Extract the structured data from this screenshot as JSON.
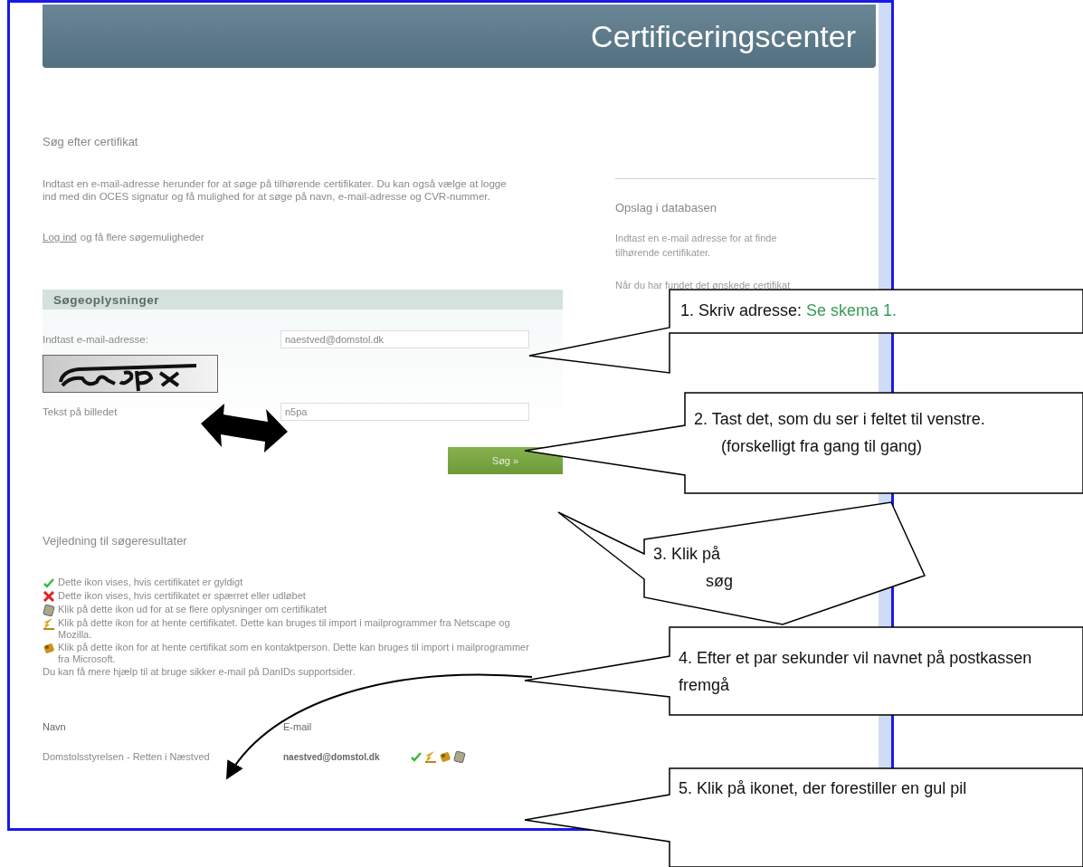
{
  "header": {
    "title": "Certificeringscenter"
  },
  "main": {
    "heading": "Søg efter certifikat",
    "intro": "Indtast en e-mail-adresse herunder for at søge på tilhørende certifikater. Du kan også vælge at logge ind med din OCES signatur og få mulighed for at søge på navn, e-mail-adresse og CVR-nummer.",
    "login_link": "Log ind",
    "login_rest": "og få flere søgemuligheder",
    "form": {
      "title": "Søgeoplysninger",
      "email_label": "Indtast e-mail-adresse:",
      "email_value": "naestved@domstol.dk",
      "captcha_label": "Tekst på billedet",
      "captcha_value": "n5pa",
      "submit": "Søg »"
    },
    "guide": {
      "heading": "Vejledning til søgeresultater",
      "items": [
        {
          "kind": "valid",
          "text": "Dette ikon vises, hvis certifikatet er gyldigt"
        },
        {
          "kind": "revoked",
          "text": "Dette ikon vises, hvis certifikatet er spærret eller udløbet"
        },
        {
          "kind": "info",
          "text": "Klik på dette ikon ud for at se flere oplysninger om certifikatet"
        },
        {
          "kind": "download",
          "text": "Klik på dette ikon for at hente certifikatet. Dette kan bruges til import i mailprogrammer fra Netscape og Mozilla."
        },
        {
          "kind": "contact",
          "text": "Klik på dette ikon for at hente certifikat som en kontaktperson. Dette kan bruges til import i mailprogrammer fra Microsoft."
        }
      ],
      "footer": "Du kan få mere hjælp til at bruge sikker e-mail på DanIDs supportsider."
    },
    "results": {
      "columns": [
        "Navn",
        "E-mail"
      ],
      "rows": [
        {
          "name": "Domstolsstyrelsen - Retten i Næstved",
          "email": "naestved@domstol.dk",
          "actions": [
            {
              "kind": "valid"
            },
            {
              "kind": "download"
            },
            {
              "kind": "contact"
            },
            {
              "kind": "info"
            }
          ]
        }
      ]
    }
  },
  "sidebar": {
    "heading": "Opslag i databasen",
    "paragraphs": [
      "Indtast en e-mail adresse for at finde tilhørende certifikater.",
      "Når du har fundet det ønskede certifikat"
    ]
  },
  "callouts": [
    {
      "lines": [
        "1. Skriv adresse:"
      ],
      "link": "Se skema 1."
    },
    {
      "lines": [
        "2. Tast det, som du ser i feltet til venstre.",
        "(forskelligt fra gang til gang)"
      ]
    },
    {
      "lines": [
        "3.   Klik på",
        "søg"
      ]
    },
    {
      "lines": [
        "4. Efter et par sekunder vil navnet på postkassen fremgå"
      ]
    },
    {
      "lines": [
        "5. Klik på ikonet, der forestiller en gul pil"
      ]
    }
  ]
}
